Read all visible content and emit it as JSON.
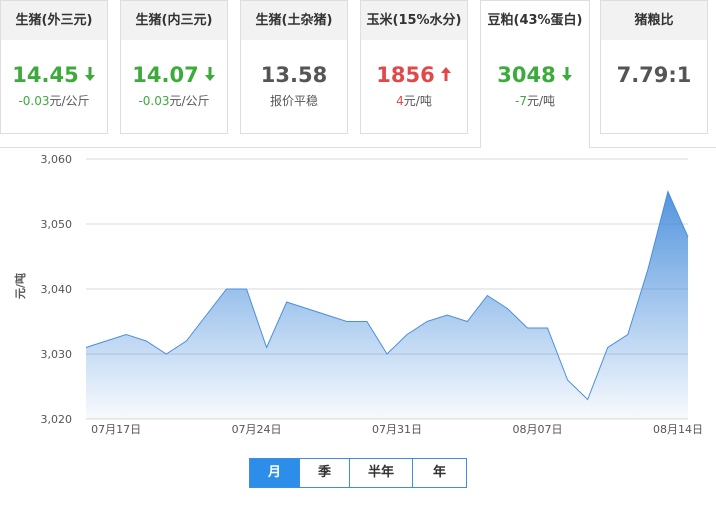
{
  "cards": [
    {
      "title": "生猪(外三元)",
      "value": "14.45",
      "trend": "down",
      "change": "-0.03",
      "unit": "元/公斤",
      "color": "#3cab3c"
    },
    {
      "title": "生猪(内三元)",
      "value": "14.07",
      "trend": "down",
      "change": "-0.03",
      "unit": "元/公斤",
      "color": "#3cab3c"
    },
    {
      "title": "生猪(土杂猪)",
      "value": "13.58",
      "trend": "flat",
      "change": "",
      "unit": "报价平稳",
      "color": "#555555"
    },
    {
      "title": "玉米(15%水分)",
      "value": "1856",
      "trend": "up",
      "change": "4",
      "unit": "元/吨",
      "color": "#e24848"
    },
    {
      "title": "豆粕(43%蛋白)",
      "value": "3048",
      "trend": "down",
      "change": "-7",
      "unit": "元/吨",
      "color": "#3cab3c",
      "active": true
    },
    {
      "title": "猪粮比",
      "value": "7.79:1",
      "trend": "none",
      "change": "",
      "unit": "",
      "color": "#555555"
    }
  ],
  "chart_data": {
    "type": "area",
    "title": "",
    "xlabel": "",
    "ylabel": "元/吨",
    "ylim": [
      3020,
      3060
    ],
    "yticks": [
      3020,
      3030,
      3040,
      3050,
      3060
    ],
    "ytick_labels": [
      "3,020",
      "3,030",
      "3,040",
      "3,050",
      "3,060"
    ],
    "xtick_labels": [
      "07月17日",
      "07月24日",
      "07月31日",
      "08月07日",
      "08月14日"
    ],
    "xtick_index": [
      1.5,
      8.5,
      15.5,
      22.5,
      29.5
    ],
    "grid": true,
    "series": [
      {
        "values": [
          3031,
          3032,
          3033,
          3032,
          3030,
          3032,
          3036,
          3040,
          3040,
          3031,
          3038,
          3037,
          3036,
          3035,
          3035,
          3030,
          3033,
          3035,
          3036,
          3035,
          3039,
          3037,
          3034,
          3034,
          3026,
          3023,
          3031,
          3033,
          3043,
          3055,
          3048
        ],
        "color": "#4a8fdc"
      }
    ]
  },
  "range_tabs": [
    {
      "label": "月",
      "active": true
    },
    {
      "label": "季",
      "active": false
    },
    {
      "label": "半年",
      "active": false
    },
    {
      "label": "年",
      "active": false
    }
  ]
}
